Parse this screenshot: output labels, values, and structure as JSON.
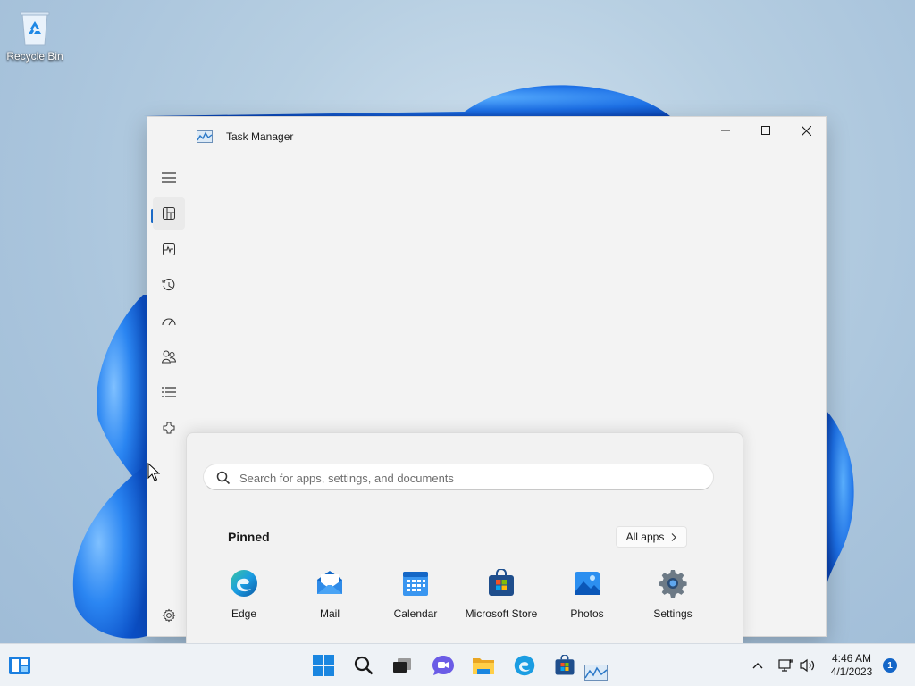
{
  "desktop": {
    "icons": [
      {
        "label": "Recycle Bin",
        "icon": "recycle-bin-icon"
      }
    ]
  },
  "task_manager": {
    "title": "Task Manager",
    "window_controls": [
      "minimize",
      "maximize",
      "close"
    ],
    "nav_items": [
      {
        "icon": "hamburger-menu-icon"
      },
      {
        "icon": "processes-icon",
        "active": true
      },
      {
        "icon": "performance-icon"
      },
      {
        "icon": "app-history-icon"
      },
      {
        "icon": "startup-apps-icon"
      },
      {
        "icon": "users-icon"
      },
      {
        "icon": "details-icon"
      },
      {
        "icon": "services-icon"
      },
      {
        "icon": "settings-gear-icon"
      }
    ]
  },
  "start_menu": {
    "search": {
      "placeholder": "Search for apps, settings, and documents",
      "value": ""
    },
    "pinned_label": "Pinned",
    "all_apps_label": "All apps",
    "pinned_apps": [
      {
        "label": "Edge",
        "icon": "edge-icon"
      },
      {
        "label": "Mail",
        "icon": "mail-icon"
      },
      {
        "label": "Calendar",
        "icon": "calendar-icon"
      },
      {
        "label": "Microsoft Store",
        "icon": "microsoft-store-icon"
      },
      {
        "label": "Photos",
        "icon": "photos-icon"
      },
      {
        "label": "Settings",
        "icon": "settings-icon"
      }
    ]
  },
  "taskbar": {
    "apps": [
      {
        "icon": "widgets-icon"
      },
      {
        "icon": "start-icon"
      },
      {
        "icon": "search-icon"
      },
      {
        "icon": "task-view-icon"
      },
      {
        "icon": "chat-icon"
      },
      {
        "icon": "file-explorer-icon"
      },
      {
        "icon": "edge-icon"
      },
      {
        "icon": "microsoft-store-icon"
      },
      {
        "icon": "task-manager-icon"
      }
    ],
    "tray": {
      "time": "4:46 AM",
      "date": "4/1/2023",
      "notification_count": "1"
    }
  }
}
